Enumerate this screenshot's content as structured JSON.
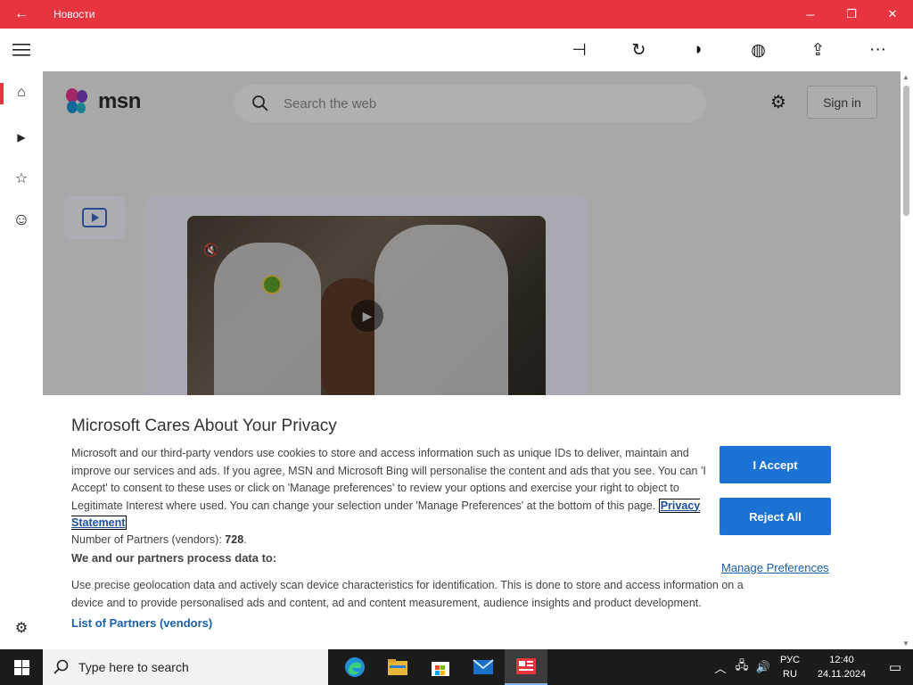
{
  "window": {
    "title": "Новости",
    "back_icon": "←",
    "minimize": "─",
    "restore": "❐",
    "close": "✕"
  },
  "toolbar": {
    "menu_icon": "hamburger-icon",
    "pin": "⊣",
    "refresh": "↻",
    "theme": "◗",
    "language": "◍",
    "share": "⇪",
    "more": "···"
  },
  "rail": {
    "items": [
      {
        "name": "home",
        "glyph": "⌂"
      },
      {
        "name": "video",
        "glyph": "▶"
      },
      {
        "name": "favorites",
        "glyph": "☆"
      },
      {
        "name": "fun",
        "glyph": "☺"
      }
    ],
    "settings_glyph": "⚙"
  },
  "msn": {
    "logo_text": "msn",
    "search_placeholder": "Search the web",
    "signin_label": "Sign in",
    "settings_glyph": "⚙"
  },
  "privacy": {
    "heading": "Microsoft Cares About Your Privacy",
    "body": "Microsoft and our third-party vendors use cookies to store and access information such as unique IDs to deliver, maintain and improve our services and ads. If you agree, MSN and Microsoft Bing will personalise the content and ads that you see. You can 'I Accept' to consent to these uses or click on 'Manage preferences' to review your options and exercise your right to object to Legitimate Interest where used. You can change your selection under 'Manage Preferences' at the bottom of this page.",
    "privacy_link": "Privacy Statement",
    "partners_label": "Number of Partners (vendors):",
    "partners_count": "728",
    "partners_suffix": ".",
    "process_title": "We and our partners process data to:",
    "process_text": "Use precise geolocation data and actively scan device characteristics for identification. This is done to store and access information on a device and to provide personalised ads and content, ad and content measurement, audience insights and product development.",
    "list_link": "List of Partners (vendors)",
    "accept_label": "I Accept",
    "reject_label": "Reject All",
    "manage_label": "Manage Preferences"
  },
  "taskbar": {
    "search_placeholder": "Type here to search",
    "tray_chevron": "︿",
    "lang_top": "РУС",
    "lang_bottom": "RU",
    "time": "12:40",
    "date": "24.11.2024",
    "notification_glyph": "▭"
  },
  "colors": {
    "titlebar": "#e8343f",
    "accent_blue": "#1a73d2",
    "link": "#1a5fa8"
  }
}
